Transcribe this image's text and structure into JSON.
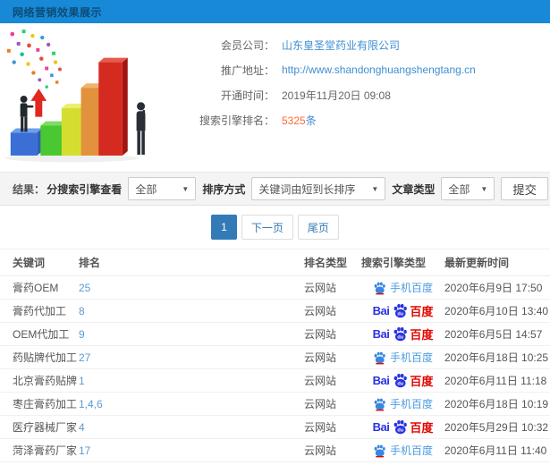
{
  "header": {
    "title": "网络营销效果展示"
  },
  "info": {
    "member_label": "会员公司：",
    "member_value": "山东皇圣堂药业有限公司",
    "url_label": "推广地址：",
    "url_value": "http://www.shandonghuangshengtang.cn",
    "opened_label": "开通时间：",
    "opened_value": "2019年11月20日 09:08",
    "rank_label": "搜索引擎排名：",
    "rank_value": "5325",
    "rank_unit": "条"
  },
  "filters": {
    "result_label": "结果：",
    "engine_label": "分搜索引擎查看",
    "engine_value": "全部",
    "sort_label": "排序方式",
    "sort_value": "关键词由短到长排序",
    "article_label": "文章类型",
    "article_value": "全部",
    "submit_label": "提交",
    "dropdown_arrow": "▼"
  },
  "pagination": {
    "current": "1",
    "next": "下一页",
    "last": "尾页"
  },
  "table": {
    "headers": {
      "keyword": "关键词",
      "rank": "排名",
      "rank_type": "排名类型",
      "engine": "搜索引擎类型",
      "updated": "最新更新时间"
    },
    "rows": [
      {
        "keyword": "膏药OEM",
        "rank": "25",
        "rank_type": "云网站",
        "engine": "mobile_baidu",
        "updated": "2020年6月9日 17:50"
      },
      {
        "keyword": "膏药代加工",
        "rank": "8",
        "rank_type": "云网站",
        "engine": "baidu_pc",
        "updated": "2020年6月10日 13:40"
      },
      {
        "keyword": "OEM代加工",
        "rank": "9",
        "rank_type": "云网站",
        "engine": "baidu_pc",
        "updated": "2020年6月5日 14:57"
      },
      {
        "keyword": "药贴牌代加工",
        "rank": "27",
        "rank_type": "云网站",
        "engine": "mobile_baidu",
        "updated": "2020年6月18日 10:25"
      },
      {
        "keyword": "北京膏药贴牌",
        "rank": "1",
        "rank_type": "云网站",
        "engine": "baidu_pc",
        "updated": "2020年6月11日 11:18"
      },
      {
        "keyword": "枣庄膏药加工",
        "rank": "1,4,6",
        "rank_type": "云网站",
        "engine": "mobile_baidu",
        "updated": "2020年6月18日 10:19"
      },
      {
        "keyword": "医疗器械厂家",
        "rank": "4",
        "rank_type": "云网站",
        "engine": "baidu_pc",
        "updated": "2020年5月29日 10:32"
      },
      {
        "keyword": "菏泽膏药厂家",
        "rank": "17",
        "rank_type": "云网站",
        "engine": "mobile_baidu",
        "updated": "2020年6月11日 11:40"
      }
    ]
  },
  "engines": {
    "mobile_baidu": {
      "label": "手机百度",
      "icon": "baidu-paw-icon"
    },
    "baidu_pc": {
      "part1": "Bai",
      "part2": "du",
      "part3": "百度",
      "icon": "baidu-paw-icon"
    }
  },
  "colors": {
    "header_blue": "#1789d6",
    "link_blue": "#3f8fd2",
    "rank_orange": "#ff6a2b",
    "pagination_blue": "#337ab7",
    "baidu_blue": "#2932e1",
    "baidu_red": "#e10601"
  }
}
